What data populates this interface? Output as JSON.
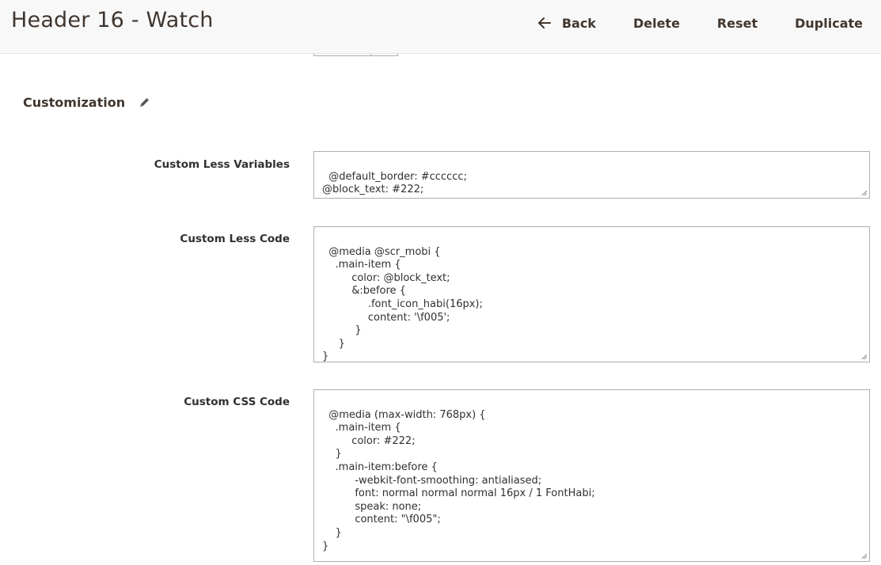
{
  "header": {
    "title": "Header 16 - Watch",
    "actions": {
      "back": "Back",
      "delete": "Delete",
      "reset": "Reset",
      "duplicate": "Duplicate"
    }
  },
  "section": {
    "title": "Customization",
    "edit_icon": "pencil-icon"
  },
  "fields": {
    "less_variables": {
      "label": "Custom Less Variables",
      "value": "@default_border: #cccccc;\n@block_text: #222;"
    },
    "less_code": {
      "label": "Custom Less Code",
      "value": "@media @scr_mobi {\n    .main-item {\n         color: @block_text;\n         &:before {\n              .font_icon_habi(16px);\n              content: '\\f005';\n          }\n     }\n}"
    },
    "css_code": {
      "label": "Custom CSS Code",
      "value": "@media (max-width: 768px) {\n    .main-item {\n         color: #222;\n    }\n    .main-item:before {\n          -webkit-font-smoothing: antialiased;\n          font: normal normal normal 16px / 1 FontHabi;\n          speak: none;\n          content: \"\\f005\";\n    }\n}"
    }
  },
  "colors": {
    "header_bg": "#f8f8f8",
    "title_text": "#41362f",
    "field_border": "#adadad"
  }
}
